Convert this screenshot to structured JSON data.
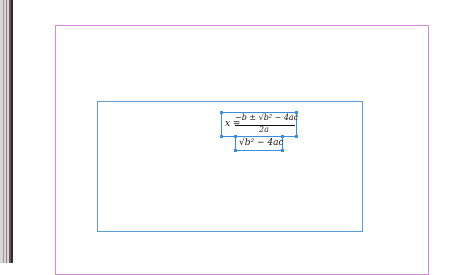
{
  "equation": {
    "variable": "x =",
    "numerator": "−b ± √b² − 4ac",
    "denominator": "2a",
    "sub_expression": "√b² − 4ac"
  },
  "colors": {
    "page_margin": "#d88ad8",
    "frame_border": "#5a9fd8",
    "selection": "#3a8ee0"
  }
}
